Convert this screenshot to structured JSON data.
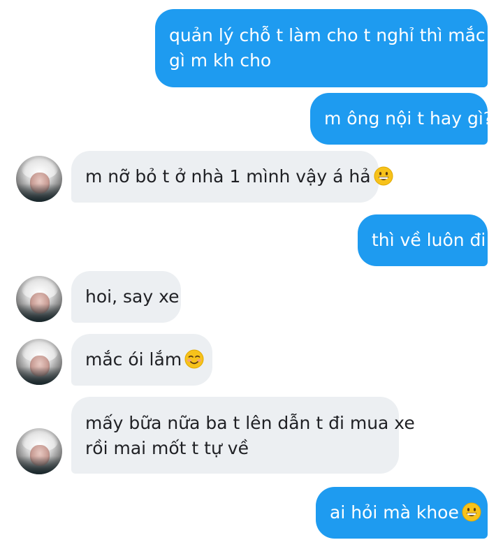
{
  "colors": {
    "sent_bubble": "#1e9bf0",
    "received_bubble": "#eceff2",
    "sent_text": "#ffffff",
    "received_text": "#1f2024"
  },
  "messages": [
    {
      "direction": "sent",
      "lines": [
        "quản lý chỗ t làm cho t nghỉ thì mắc",
        "gì m kh cho"
      ]
    },
    {
      "direction": "sent",
      "lines": [
        "m ông nội t hay gì?"
      ]
    },
    {
      "direction": "received",
      "lines": [
        "m nỡ bỏ t ở nhà 1 mình vậy á hả"
      ],
      "emoji": "grinning-face"
    },
    {
      "direction": "sent",
      "lines": [
        "thì về luôn đi"
      ]
    },
    {
      "direction": "received",
      "lines": [
        "hoi, say xe"
      ]
    },
    {
      "direction": "received",
      "lines": [
        "mắc ói lắm"
      ],
      "emoji": "smiling-face"
    },
    {
      "direction": "received",
      "lines": [
        "mấy bữa nữa ba t lên dẫn t đi mua xe",
        "rồi mai mốt t tự về"
      ]
    },
    {
      "direction": "sent",
      "lines": [
        "ai hỏi mà khoe"
      ],
      "emoji": "grinning-face"
    }
  ]
}
